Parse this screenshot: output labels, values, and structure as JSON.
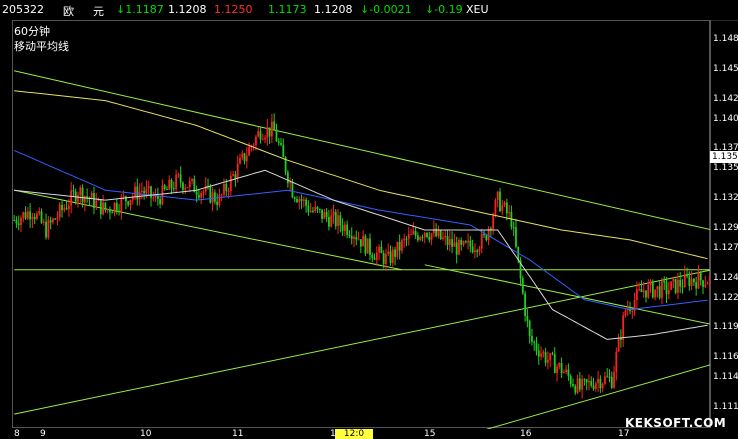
{
  "header": {
    "code": "205322",
    "name_1": "欧",
    "name_2": "元",
    "last": "↓1.1187",
    "open": "1.1208",
    "high": "1.1250",
    "low": "1.1173",
    "prev": "1.1208",
    "change": "↓-0.0021",
    "change_pct": "↓-0.19",
    "symbol": "XEU"
  },
  "overlay": {
    "period": "60分钟",
    "indicator": "移动平均线"
  },
  "colors": {
    "background": "#000000",
    "up_candle": "#ff2020",
    "down_candle": "#20d020",
    "trendline": "#99ee44",
    "ma_yellow": "#e8e060",
    "ma_blue": "#3060ff",
    "ma_white": "#d8d8d8"
  },
  "chart_data": {
    "type": "candlestick",
    "y_ticks": [
      "1.148",
      "1.145",
      "1.142",
      "1.140",
      "1.137",
      "1.135",
      "1.132",
      "1.129",
      "1.127",
      "1.124",
      "1.122",
      "1.119",
      "1.116",
      "1.114",
      "1.111"
    ],
    "x_ticks": [
      "8",
      "9",
      "10",
      "11",
      "12",
      "15",
      "16",
      "17"
    ],
    "current_price": "1.135",
    "x_marker": "12:0",
    "ylim": [
      1.109,
      1.15
    ],
    "waypoints": [
      [
        0,
        1.13
      ],
      [
        8,
        1.131
      ],
      [
        14,
        1.129
      ],
      [
        28,
        1.133
      ],
      [
        40,
        1.131
      ],
      [
        56,
        1.133
      ],
      [
        62,
        1.132
      ],
      [
        72,
        1.134
      ],
      [
        82,
        1.133
      ],
      [
        90,
        1.132
      ],
      [
        100,
        1.136
      ],
      [
        108,
        1.139
      ],
      [
        114,
        1.139
      ],
      [
        122,
        1.133
      ],
      [
        130,
        1.131
      ],
      [
        140,
        1.13
      ],
      [
        148,
        1.129
      ],
      [
        156,
        1.127
      ],
      [
        164,
        1.126
      ],
      [
        172,
        1.128
      ],
      [
        180,
        1.129
      ],
      [
        188,
        1.128
      ],
      [
        196,
        1.127
      ],
      [
        206,
        1.128
      ],
      [
        212,
        1.132
      ],
      [
        218,
        1.13
      ],
      [
        226,
        1.118
      ],
      [
        234,
        1.116
      ],
      [
        240,
        1.115
      ],
      [
        248,
        1.113
      ],
      [
        256,
        1.114
      ],
      [
        262,
        1.114
      ],
      [
        268,
        1.121
      ],
      [
        276,
        1.123
      ],
      [
        286,
        1.123
      ],
      [
        296,
        1.124
      ],
      [
        306,
        1.124
      ]
    ],
    "ma_yellow": [
      [
        0,
        1.143
      ],
      [
        40,
        1.142
      ],
      [
        80,
        1.1395
      ],
      [
        120,
        1.136
      ],
      [
        160,
        1.133
      ],
      [
        200,
        1.131
      ],
      [
        240,
        1.129
      ],
      [
        270,
        1.128
      ],
      [
        306,
        1.126
      ]
    ],
    "ma_blue": [
      [
        0,
        1.137
      ],
      [
        40,
        1.133
      ],
      [
        80,
        1.132
      ],
      [
        120,
        1.133
      ],
      [
        160,
        1.131
      ],
      [
        200,
        1.1295
      ],
      [
        226,
        1.126
      ],
      [
        250,
        1.122
      ],
      [
        270,
        1.121
      ],
      [
        306,
        1.122
      ]
    ],
    "ma_white": [
      [
        0,
        1.133
      ],
      [
        40,
        1.132
      ],
      [
        80,
        1.133
      ],
      [
        110,
        1.135
      ],
      [
        140,
        1.132
      ],
      [
        180,
        1.129
      ],
      [
        212,
        1.129
      ],
      [
        236,
        1.121
      ],
      [
        260,
        1.118
      ],
      [
        280,
        1.1185
      ],
      [
        306,
        1.1195
      ]
    ],
    "trendlines": [
      [
        [
          0,
          1.145
        ],
        [
          306,
          1.129
        ]
      ],
      [
        [
          0,
          1.133
        ],
        [
          170,
          1.125
        ]
      ],
      [
        [
          0,
          1.125
        ],
        [
          306,
          1.125
        ]
      ],
      [
        [
          0,
          1.1105
        ],
        [
          306,
          1.125
        ]
      ],
      [
        [
          180,
          1.1255
        ],
        [
          306,
          1.1195
        ]
      ],
      [
        [
          200,
          1.1085
        ],
        [
          306,
          1.1155
        ]
      ]
    ]
  },
  "watermark": "KEKSOFT.COM"
}
